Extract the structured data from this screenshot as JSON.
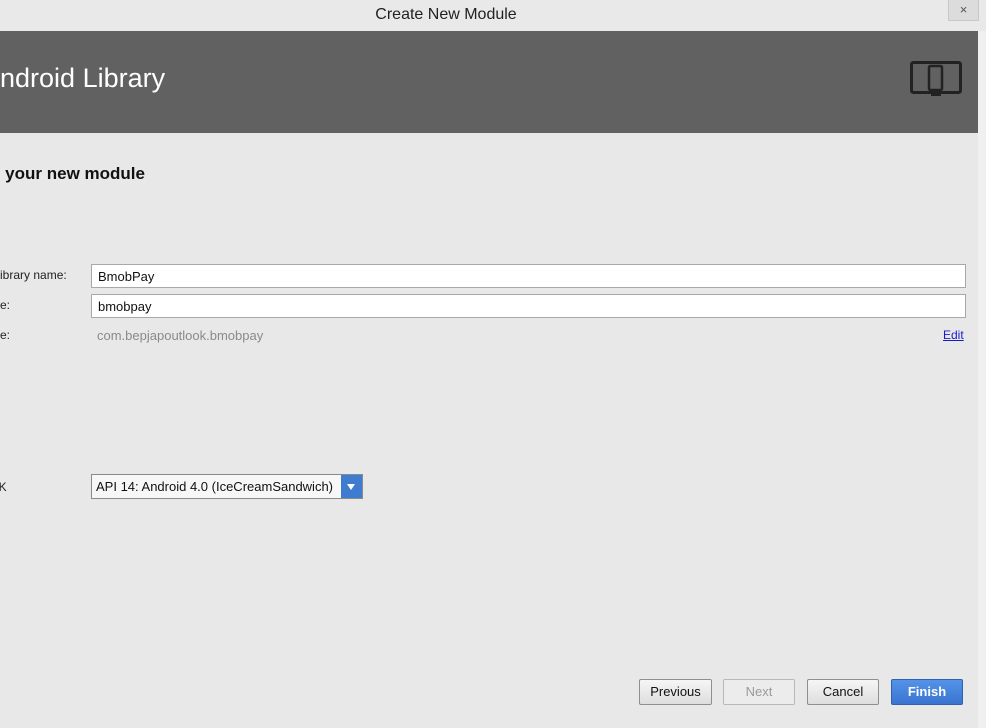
{
  "window": {
    "title": "Create New Module",
    "close_label": "×"
  },
  "banner": {
    "title": "Android Library",
    "icon": "device-icon"
  },
  "section": {
    "heading": "e your new module"
  },
  "form": {
    "library_name_label": "/Library name:",
    "library_name_value": "BmobPay",
    "module_name_label": "me:",
    "module_name_value": "bmobpay",
    "package_name_label": "me:",
    "package_name_value": "com.bepjapoutlook.bmobpay",
    "edit_label": "Edit",
    "min_sdk_label": "DK",
    "min_sdk_value": "API 14: Android 4.0 (IceCreamSandwich)"
  },
  "buttons": {
    "previous": "Previous",
    "next": "Next",
    "cancel": "Cancel",
    "finish": "Finish"
  },
  "colors": {
    "banner_bg": "#616161",
    "accent": "#3f7ccf",
    "link": "#1a1acc"
  }
}
